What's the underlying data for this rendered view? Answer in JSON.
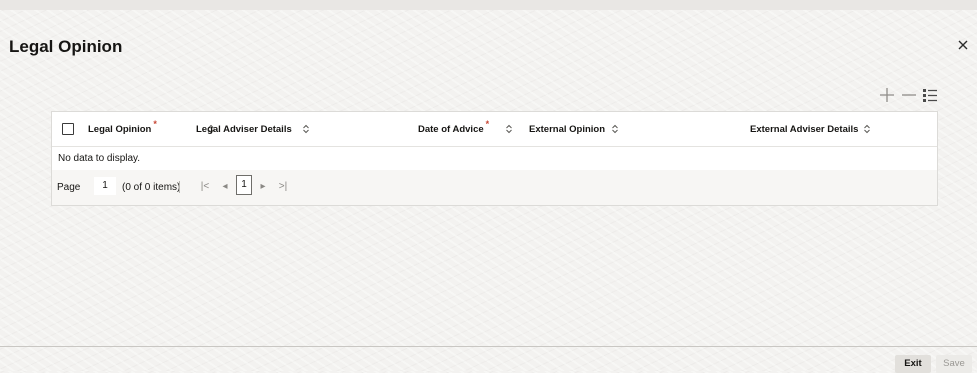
{
  "page": {
    "title": "Legal Opinion",
    "close_icon": "close-icon"
  },
  "toolbar": {
    "add_icon": "plus-icon",
    "remove_icon": "minus-icon",
    "columns_icon": "list-columns-icon"
  },
  "grid": {
    "columns": [
      {
        "label": "Legal Opinion",
        "required": true
      },
      {
        "label": "Legal Adviser Details",
        "required": false
      },
      {
        "label": "Date of Advice",
        "required": true
      },
      {
        "label": "External Opinion",
        "required": false
      },
      {
        "label": "External Adviser Details",
        "required": false
      }
    ],
    "required_mark": "*",
    "empty_message": "No data to display."
  },
  "pager": {
    "page_label": "Page",
    "page_value": "1",
    "items_text": "(0 of 0 items)",
    "first_icon": "|<",
    "prev_icon": "◂",
    "current_page": "1",
    "next_icon": "▸",
    "last_icon": ">|"
  },
  "footer": {
    "exit_label": "Exit",
    "save_label": "Save"
  }
}
